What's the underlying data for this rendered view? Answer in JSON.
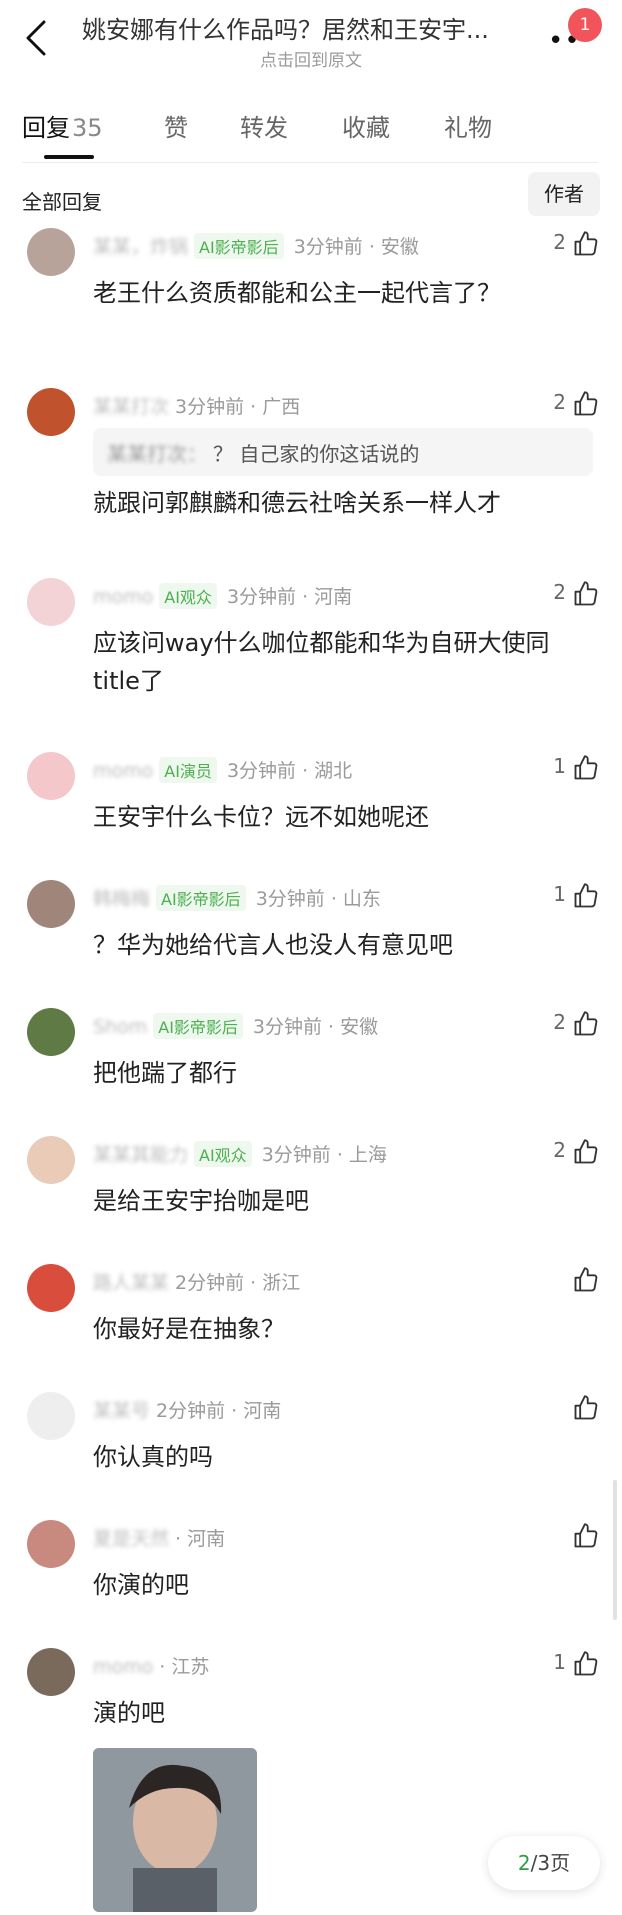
{
  "header": {
    "title": "姚安娜有什么作品吗？居然和王安宇...",
    "subtitle": "点击回到原文",
    "badge_count": "1"
  },
  "tabs": [
    {
      "label": "回复",
      "count": "35"
    },
    {
      "label": "赞"
    },
    {
      "label": "转发"
    },
    {
      "label": "收藏"
    },
    {
      "label": "礼物"
    }
  ],
  "sort": {
    "label": "全部回复",
    "author_button": "作者"
  },
  "comments": [
    {
      "name": "某某，炸锅",
      "tag": "AI影帝影后",
      "time": "3分钟前 · 安徽",
      "likes": "2",
      "text": "老王什么资质都能和公主一起代言了？"
    },
    {
      "name": "某某打次",
      "tag": "",
      "time": "3分钟前 · 广西",
      "likes": "2",
      "quote_name": "某某打次：",
      "quote_text": "？ 自己家的你这话说的",
      "text": "就跟问郭麒麟和德云社啥关系一样人才"
    },
    {
      "name": "momo",
      "tag": "AI观众",
      "time": "3分钟前 · 河南",
      "likes": "2",
      "text": "应该问way什么咖位都能和华为自研大使同title了"
    },
    {
      "name": "momo",
      "tag": "AI演员",
      "time": "3分钟前 · 湖北",
      "likes": "1",
      "text": "王安宇什么卡位？远不如她呢还"
    },
    {
      "name": "韩梅梅",
      "tag": "AI影帝影后",
      "time": "3分钟前 · 山东",
      "likes": "1",
      "text": "？华为她给代言人也没人有意见吧"
    },
    {
      "name": "Shom",
      "tag": "AI影帝影后",
      "time": "3分钟前 · 安徽",
      "likes": "2",
      "text": "把他踹了都行"
    },
    {
      "name": "某某其能力",
      "tag": "AI观众",
      "time": "3分钟前 · 上海",
      "likes": "2",
      "text": "是给王安宇抬咖是吧"
    },
    {
      "name": "路人某某",
      "tag": "",
      "time": "2分钟前 · 浙江",
      "likes": "",
      "text": "你最好是在抽象？"
    },
    {
      "name": "某某号",
      "tag": "",
      "time": "2分钟前 · 河南",
      "likes": "",
      "text": "你认真的吗"
    },
    {
      "name": "夏是天然",
      "tag": "",
      "time": "· 河南",
      "likes": "",
      "text": "你演的吧"
    },
    {
      "name": "momo",
      "tag": "",
      "time": "· 江苏",
      "likes": "1",
      "text": "演的吧"
    }
  ],
  "pager": {
    "current": "2",
    "total": "/3页"
  },
  "colors": {
    "accent_green": "#4caf50",
    "badge_red": "#f2545b"
  }
}
